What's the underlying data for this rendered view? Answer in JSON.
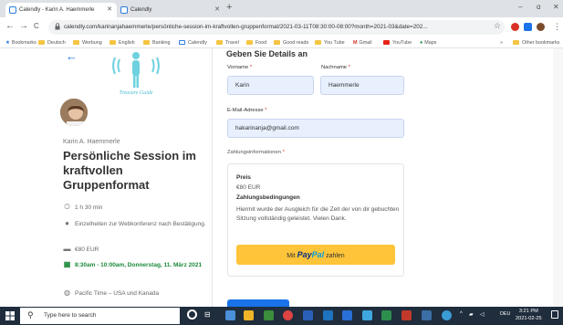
{
  "browser": {
    "tabs": [
      {
        "label": "Calendly - Karin A. Haemmerle"
      },
      {
        "label": "Calendly"
      }
    ],
    "new_tab": "+",
    "window_controls": [
      "–",
      "ɑ",
      "✕"
    ],
    "nav": {
      "back": "←",
      "forward": "→",
      "reload": "C"
    },
    "url": "calendly.com/karinanjahaemmerle/persönliche-session-im-kraftvollen-gruppenformat/2021-03-11T08:30:00-08:00?month=2021-03&date=202...",
    "bookmarks": [
      "Bookmarks",
      "Deutsch",
      "Werbung",
      "English",
      "Banking",
      "Calendly",
      "Travel",
      "Food",
      "Good reads",
      "You Tube",
      "Gmail",
      "YouTube",
      "Maps"
    ],
    "bookmarks_overflow": "»",
    "other_bookmarks": "Other bookmarks"
  },
  "event": {
    "logo_caption": "Treasure Guide",
    "host_name": "Karin A. Haemmerle",
    "title": "Persönliche Session im kraftvollen Gruppenformat",
    "duration": "1 h 30 min",
    "conference": "Einzelheiten zur Webkonferenz nach Bestätigung.",
    "price": "€80 EUR",
    "datetime": "8:30am - 10:00am, Donnerstag, 11. März 2021",
    "timezone": "Pacific Time – USA und Kanada"
  },
  "form": {
    "heading": "Geben Sie Details an",
    "first_name_label": "Vorname",
    "first_name_value": "Karin",
    "last_name_label": "Nachname",
    "last_name_value": "Haemmerle",
    "email_label": "E-Mail-Adresse",
    "email_value": "hakarinanja@gmail.com",
    "payment_label": "Zahlungsinformationen",
    "required_mark": "*",
    "price_label": "Preis",
    "price_value": "€80 EUR",
    "terms_label": "Zahlungsbedingungen",
    "terms_text": "Hiermit wurde der Ausgleich für die Zeit der von dir gebuchten Sitzung vollständig geleistet. Vielen Dank.",
    "paypal_prefix": "Mit",
    "paypal_brand_pay": "Pay",
    "paypal_brand_pal": "Pal",
    "paypal_suffix": "zahlen"
  },
  "taskbar": {
    "search_placeholder": "Type here to search",
    "language": "DEU",
    "time": "3:21 PM",
    "date": "2021-02-25"
  },
  "colors": {
    "accent": "#1a73e8",
    "paypal": "#ffc439",
    "field_bg": "#e8f0fe",
    "confirmed": "#1b8a3a",
    "taskbar": "#1f2d3d"
  }
}
